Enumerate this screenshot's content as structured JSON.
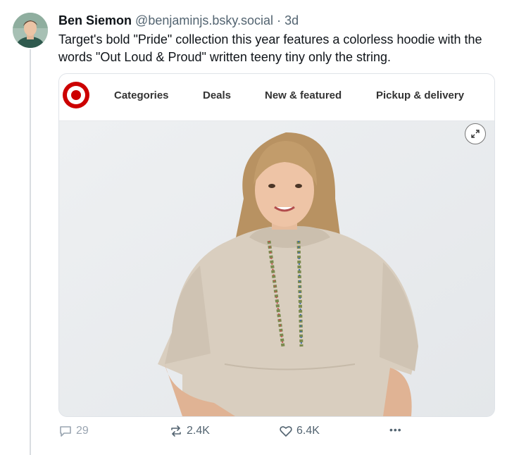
{
  "post": {
    "author_name": "Ben Siemon",
    "handle": "@benjaminjs.bsky.social",
    "separator": "·",
    "time": "3d",
    "text": "Target's bold \"Pride\" collection this year features a colorless hoodie with the words \"Out Loud & Proud\" written teeny tiny only the string."
  },
  "embed": {
    "nav_items": [
      "Categories",
      "Deals",
      "New & featured",
      "Pickup & delivery"
    ],
    "brand_color": "#cc0000"
  },
  "actions": {
    "reply_count": "29",
    "repost_count": "2.4K",
    "like_count": "6.4K",
    "more_label": "•••"
  },
  "icons": [
    "avatar",
    "target-logo-icon",
    "expand-icon",
    "reply-icon",
    "repost-icon",
    "like-icon",
    "more-icon"
  ]
}
